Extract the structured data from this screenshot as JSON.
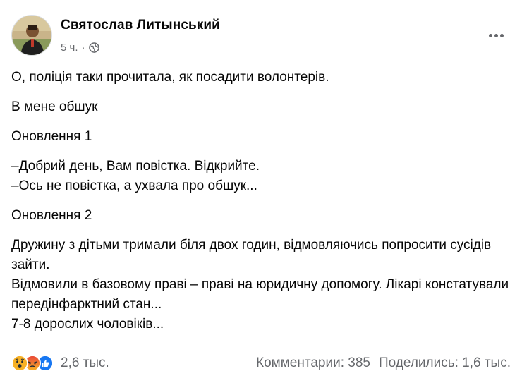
{
  "post": {
    "author": "Святослав Литынський",
    "time": "5 ч.",
    "separator": "·",
    "privacy_icon": "globe-icon",
    "more_icon": "more-horizontal-icon",
    "paragraphs": [
      "О, поліція таки прочитала, як посадити волонтерів.",
      "В мене обшук",
      "Оновлення 1",
      "–Добрий день, Вам повістка. Відкрийте.\n–Ось не повістка, а ухвала про обшук...",
      "Оновлення 2",
      "Дружину з дітьми тримали біля двох годин, відмовляючись попросити сусідів зайти.\nВідмовили в базовому праві – праві на юридичну допомогу. Лікарі констатували передінфарктний стан...\n7-8 дорослих чоловіків..."
    ]
  },
  "footer": {
    "reactions": [
      "wow-icon",
      "angry-icon",
      "like-icon"
    ],
    "reaction_count": "2,6 тыс.",
    "comments": "Комментарии: 385",
    "shares": "Поделились: 1,6 тыс."
  },
  "colors": {
    "text": "#050505",
    "secondary": "#65676b",
    "like": "#1877f2",
    "wow": "#f7b125",
    "angry": "#e9710f"
  }
}
